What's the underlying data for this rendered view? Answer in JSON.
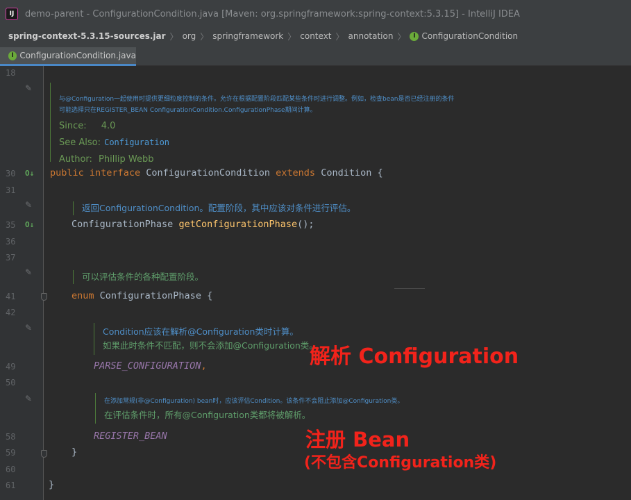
{
  "window": {
    "title": "demo-parent - ConfigurationCondition.java [Maven: org.springframework:spring-context:5.3.15] - IntelliJ IDEA",
    "app_icon_glyph": "IJ"
  },
  "breadcrumbs": {
    "jar": "spring-context-5.3.15-sources.jar",
    "items": [
      "org",
      "springframework",
      "context",
      "annotation"
    ],
    "class_badge": "I",
    "class_name": "ConfigurationCondition",
    "separator": "〉"
  },
  "tab": {
    "badge": "I",
    "label": "ConfigurationCondition.java"
  },
  "line_numbers": {
    "l18": "18",
    "l30": "30",
    "l31": "31",
    "l35": "35",
    "l36": "36",
    "l37": "37",
    "l41": "41",
    "l42": "42",
    "l49": "49",
    "l50": "50",
    "l58": "58",
    "l59": "59",
    "l60": "60",
    "l61": "61"
  },
  "gutter_icons": {
    "implemented": "O↓",
    "edit": "✎"
  },
  "doc_interface": {
    "line1": "与@Configuration一起使用时提供更细粒度控制的条件。允许在根据配置阶段匹配某些条件时进行调整。例如，检查bean是否已经注册的条件",
    "line2": "可能选择只在REGISTER_BEAN ConfigurationCondition.ConfigurationPhase期间计算。",
    "since_label": "Since:",
    "since_value": "4.0",
    "see_label": "See Also:",
    "see_value": "Configuration",
    "author_label": "Author:",
    "author_value": "Phillip Webb"
  },
  "code": {
    "l30": {
      "public": "public",
      "interface": "interface",
      "name": " ConfigurationCondition ",
      "extends": "extends",
      "rest": " Condition {"
    },
    "l35": {
      "type": "ConfigurationPhase ",
      "method": "getConfigurationPhase",
      "rest": "();"
    },
    "l41": {
      "enum": "enum",
      "rest": " ConfigurationPhase {"
    },
    "l49": {
      "constant": "PARSE_CONFIGURATION",
      "comma": ","
    },
    "l58": {
      "constant": "REGISTER_BEAN"
    },
    "l59": "}",
    "l61": "}"
  },
  "doc_method": {
    "text": "返回ConfigurationCondition。配置阶段，其中应该对条件进行评估。"
  },
  "doc_enum": {
    "text": "可以评估条件的各种配置阶段。"
  },
  "doc_parse": {
    "line1": "Condition应该在解析@Configuration类时计算。",
    "line2": "如果此时条件不匹配，则不会添加@Configuration类。"
  },
  "doc_register": {
    "line1": "在添加常规(非@Configuration) bean时，应该评估Condition。该条件不会阻止添加@Configuration类。",
    "line2": "在评估条件时，所有@Configuration类都将被解析。"
  },
  "annotations": {
    "parse": "解析 Configuration",
    "register": "注册 Bean",
    "register_note": "(不包含Configuration类)"
  },
  "colors": {
    "keyword": "#cc7832",
    "method": "#ffc66d",
    "constant": "#9876aa",
    "doc": "#5f9e6b",
    "annotation_red": "#f2231b"
  }
}
